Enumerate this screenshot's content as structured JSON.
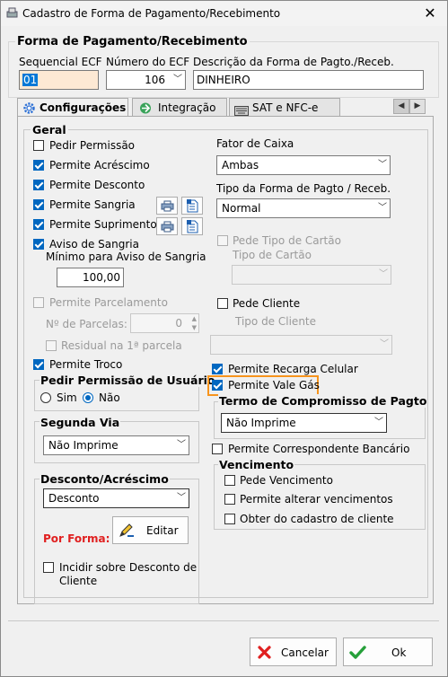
{
  "window": {
    "title": "Cadastro de Forma de Pagamento/Recebimento",
    "close_glyph": "✕"
  },
  "main": {
    "group_title": "Forma de Pagamento/Recebimento",
    "seq_label": "Sequencial ECF",
    "seq_value": "01",
    "num_label": "Número do ECF",
    "num_value": "106",
    "desc_label": "Descrição da Forma de Pagto./Receb.",
    "desc_value": "DINHEIRO"
  },
  "tabs": [
    {
      "label": "Configurações"
    },
    {
      "label": "Integração"
    },
    {
      "label": "SAT e NFC-e"
    }
  ],
  "geral": {
    "title": "Geral",
    "pedir_permissao": "Pedir Permissão",
    "permite_acrescimo": "Permite Acréscimo",
    "permite_desconto": "Permite Desconto",
    "permite_sangria": "Permite Sangria",
    "permite_suprimento": "Permite Suprimento",
    "aviso_sangria": "Aviso de Sangria",
    "minimo_aviso_label": "Mínimo para Aviso de Sangria",
    "minimo_aviso_value": "100,00",
    "permite_parcelamento": "Permite Parcelamento",
    "num_parcelas_label": "Nº de Parcelas:",
    "num_parcelas_value": "0",
    "residual": "Residual na 1ª parcela",
    "permite_troco": "Permite Troco"
  },
  "right": {
    "fator_caixa_label": "Fator de Caixa",
    "fator_caixa_value": "Ambas",
    "tipo_forma_label": "Tipo da Forma de Pagto / Receb.",
    "tipo_forma_value": "Normal",
    "pede_tipo_cartao": "Pede Tipo de Cartão",
    "tipo_cartao_label": "Tipo de Cartão",
    "pede_cliente": "Pede Cliente",
    "tipo_cliente_label": "Tipo de Cliente",
    "permite_recarga": "Permite Recarga Celular",
    "permite_vale_gas": "Permite Vale Gás",
    "termo_title": "Termo de Compromisso de Pagto",
    "termo_value": "Não Imprime",
    "permite_correspondente": "Permite Correspondente Bancário",
    "vencimento_title": "Vencimento",
    "pede_vencimento": "Pede Vencimento",
    "permite_alterar_venc": "Permite alterar vencimentos",
    "obter_cadastro": "Obter do cadastro de cliente"
  },
  "pedir_permissao_usuario": {
    "title": "Pedir Permissão de Usuário",
    "sim": "Sim",
    "nao": "Não"
  },
  "segunda_via": {
    "title": "Segunda Via",
    "value": "Não Imprime"
  },
  "desconto": {
    "title": "Desconto/Acréscimo",
    "value": "Desconto",
    "por_forma": "Por Forma:",
    "editar": "Editar",
    "incidir": "Incidir sobre Desconto de",
    "incidir2": "Cliente"
  },
  "footer": {
    "cancelar": "Cancelar",
    "ok": "Ok"
  },
  "colors": {
    "highlight": "#f7941d",
    "accent": "#0067c0",
    "por_forma": "#e02020"
  }
}
